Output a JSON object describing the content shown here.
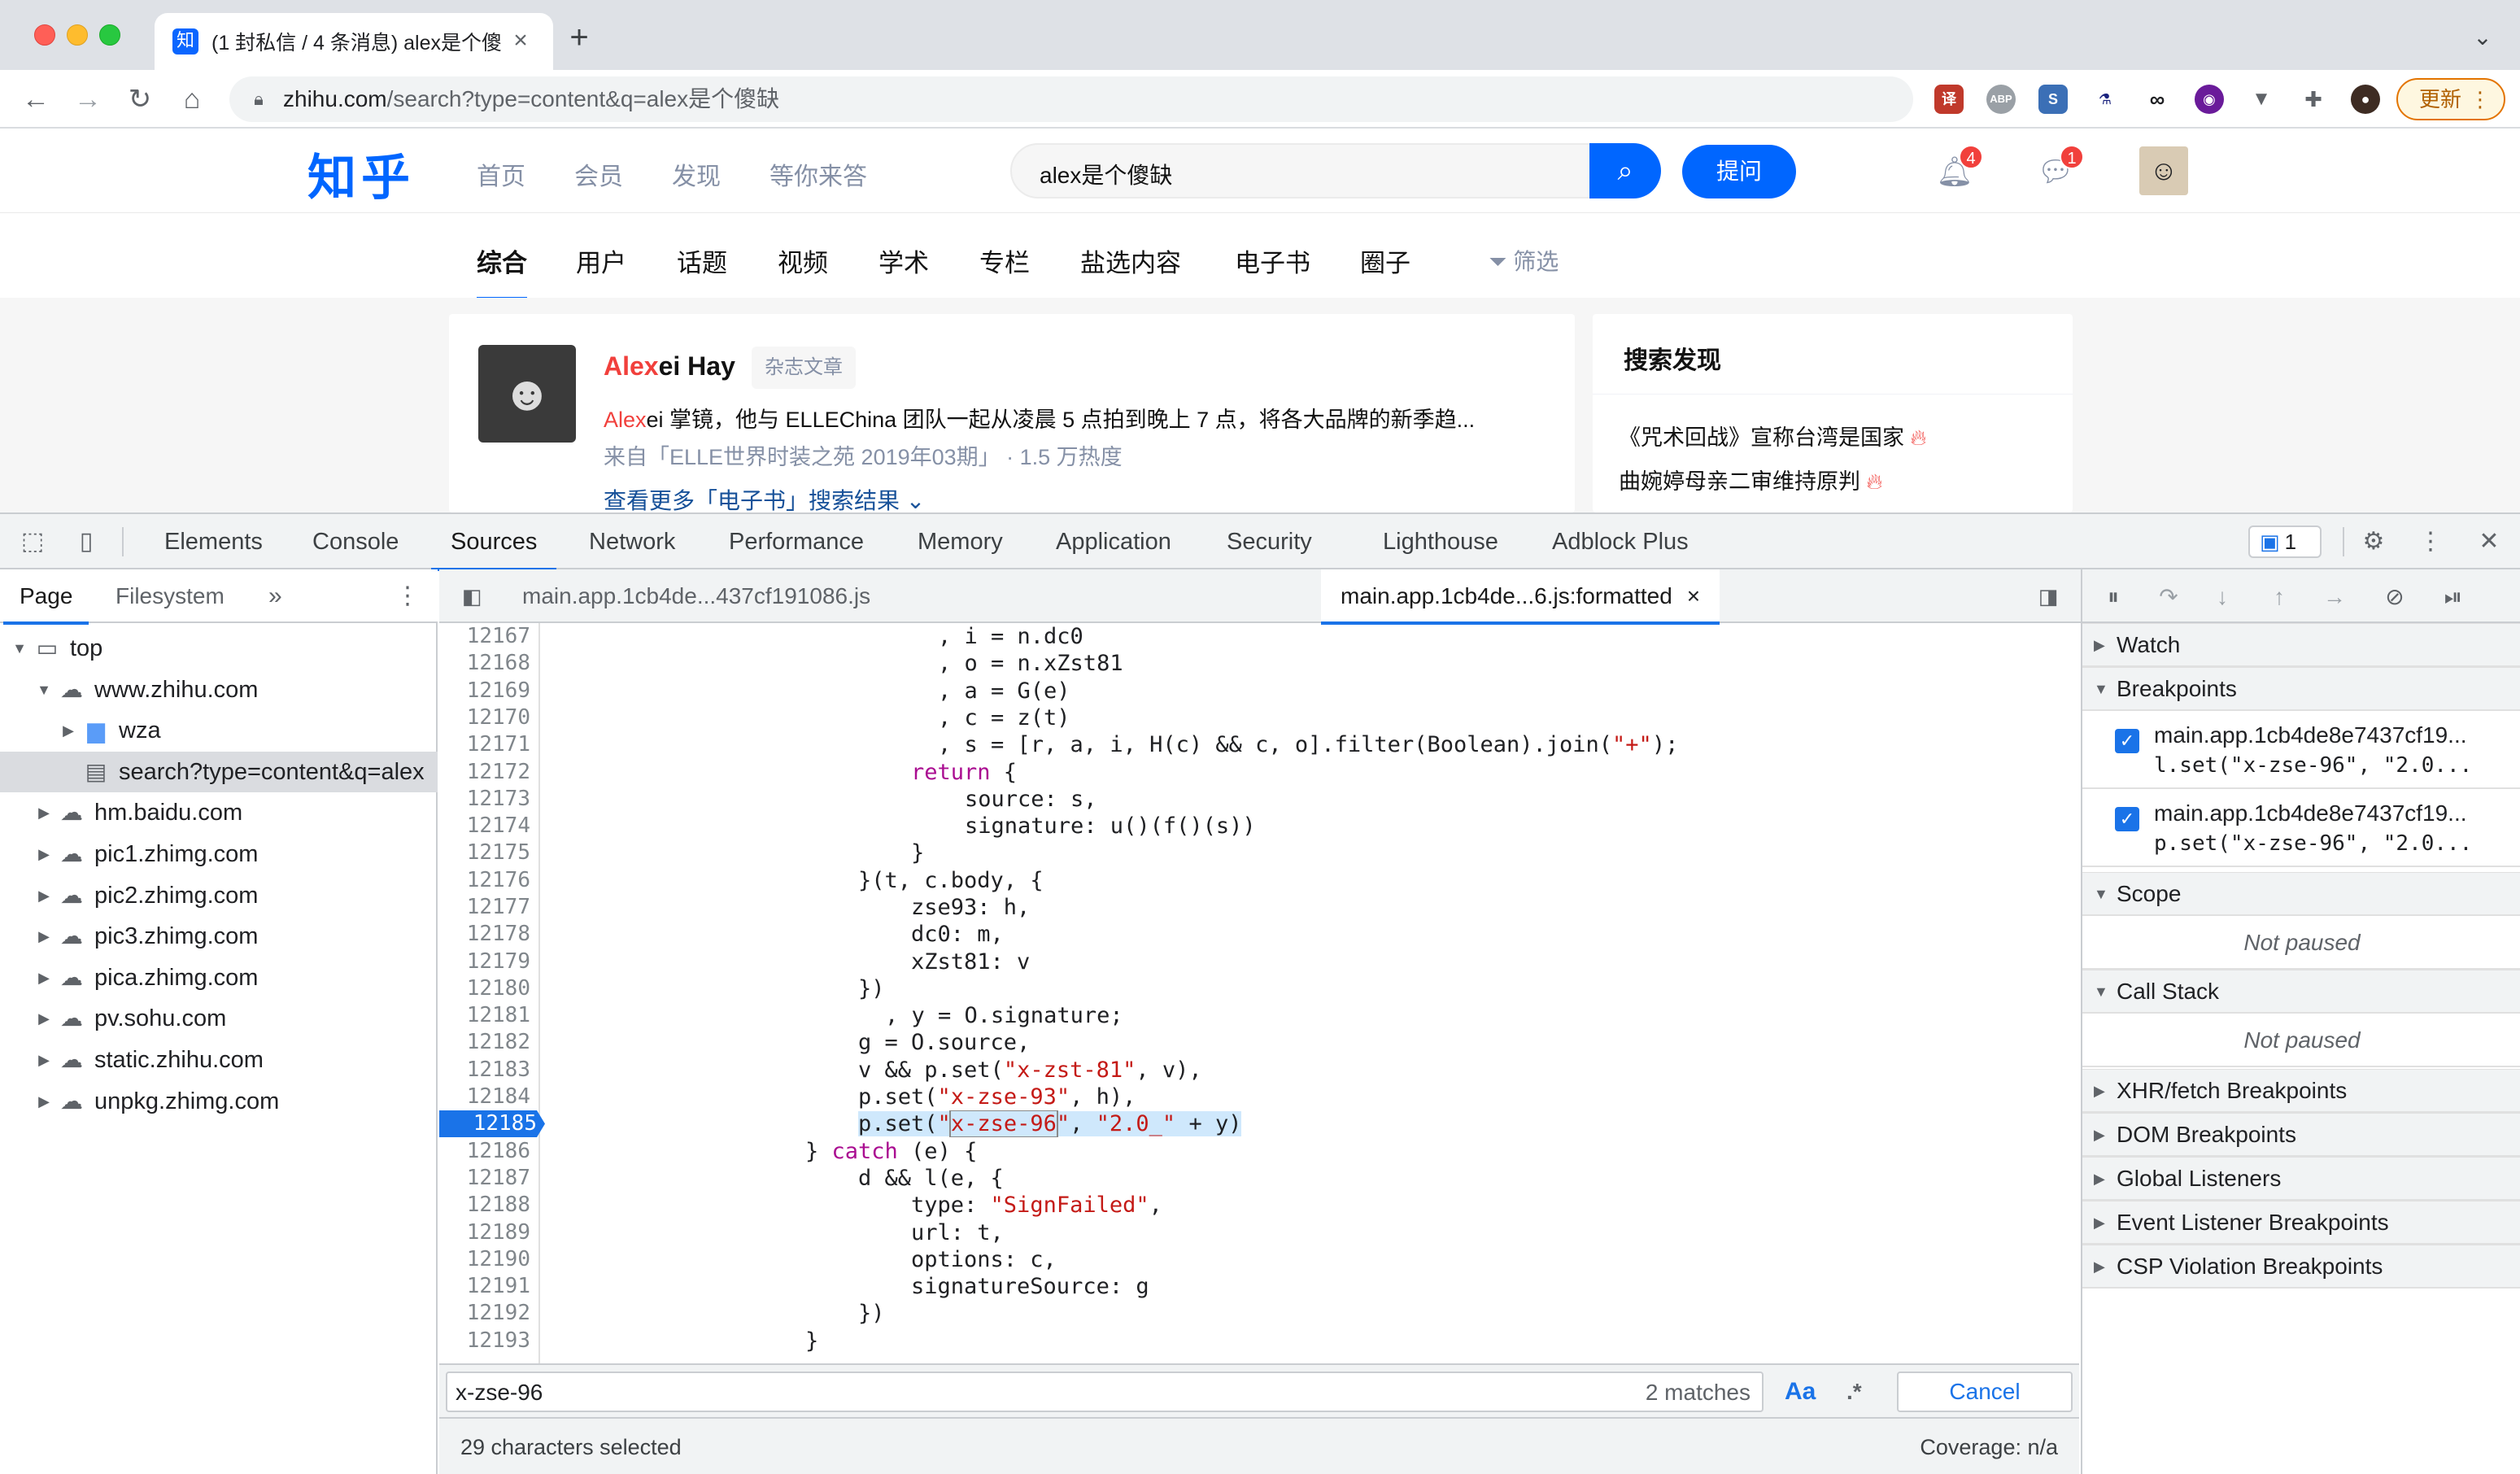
{
  "browser": {
    "tab_title": "(1 封私信 / 4 条消息) alex是个傻",
    "tab_favicon": "知",
    "url_host": "zhihu.com",
    "url_path": "/search?type=content&q=alex是个傻缺",
    "update_label": "更新",
    "icons": [
      "back-icon",
      "forward-icon",
      "reload-icon",
      "home-icon",
      "lock-icon",
      "share-icon",
      "star-icon",
      "extensions-icon",
      "profile-icon",
      "menu-icon"
    ]
  },
  "zhihu": {
    "logo": "知乎",
    "nav": [
      "首页",
      "会员",
      "发现",
      "等你来答"
    ],
    "search_value": "alex是个傻缺",
    "ask_label": "提问",
    "notifications_badge": "4",
    "messages_badge": "1",
    "tabs": [
      "综合",
      "用户",
      "话题",
      "视频",
      "学术",
      "专栏",
      "盐选内容",
      "电子书",
      "圈子"
    ],
    "filter_label": "筛选",
    "card": {
      "name_hl": "Alex",
      "name_rest": "ei Hay",
      "tag": "杂志文章",
      "desc_hl": "Alex",
      "desc_rest": "ei 掌镜，他与 ELLEChina 团队一起从凌晨 5 点拍到晚上 7 点，将各大品牌的新季趋...",
      "meta": "来自「ELLE世界时装之苑 2019年03期」 · 1.5 万热度",
      "more": "查看更多「电子书」搜索结果"
    },
    "side": {
      "title": "搜索发现",
      "items": [
        "《咒术回战》宣称台湾是国家",
        "曲婉婷母亲二审维持原判"
      ]
    }
  },
  "devtools": {
    "tabs": [
      "Elements",
      "Console",
      "Sources",
      "Network",
      "Performance",
      "Memory",
      "Application",
      "Security",
      "Lighthouse",
      "Adblock Plus"
    ],
    "active_tab": "Sources",
    "issues_count": "1",
    "navigator": {
      "tabs": [
        "Page",
        "Filesystem"
      ],
      "tree": [
        {
          "label": "top",
          "depth": 0,
          "kind": "frame",
          "expanded": true
        },
        {
          "label": "www.zhihu.com",
          "depth": 1,
          "kind": "domain",
          "expanded": true
        },
        {
          "label": "wza",
          "depth": 2,
          "kind": "folder",
          "expanded": false
        },
        {
          "label": "search?type=content&q=alex",
          "depth": 2,
          "kind": "file",
          "selected": true
        },
        {
          "label": "hm.baidu.com",
          "depth": 1,
          "kind": "domain",
          "expanded": false
        },
        {
          "label": "pic1.zhimg.com",
          "depth": 1,
          "kind": "domain",
          "expanded": false
        },
        {
          "label": "pic2.zhimg.com",
          "depth": 1,
          "kind": "domain",
          "expanded": false
        },
        {
          "label": "pic3.zhimg.com",
          "depth": 1,
          "kind": "domain",
          "expanded": false
        },
        {
          "label": "pica.zhimg.com",
          "depth": 1,
          "kind": "domain",
          "expanded": false
        },
        {
          "label": "pv.sohu.com",
          "depth": 1,
          "kind": "domain",
          "expanded": false
        },
        {
          "label": "static.zhihu.com",
          "depth": 1,
          "kind": "domain",
          "expanded": false
        },
        {
          "label": "unpkg.zhimg.com",
          "depth": 1,
          "kind": "domain",
          "expanded": false
        }
      ]
    },
    "editor": {
      "tabs": [
        "main.app.1cb4de...437cf191086.js",
        "main.app.1cb4de...6.js:formatted"
      ],
      "active_tab": 1,
      "breakpoint_line": 12185,
      "lines": [
        {
          "n": "12167",
          "indent": 30,
          "parts": [
            [
              ", i = n.dc0",
              ""
            ]
          ]
        },
        {
          "n": "12168",
          "indent": 30,
          "parts": [
            [
              ", o = n.xZst81",
              ""
            ]
          ]
        },
        {
          "n": "12169",
          "indent": 30,
          "parts": [
            [
              ", a = G(e)",
              ""
            ]
          ]
        },
        {
          "n": "12170",
          "indent": 30,
          "parts": [
            [
              ", c = z(t)",
              ""
            ]
          ]
        },
        {
          "n": "12171",
          "indent": 30,
          "parts": [
            [
              ", s = [r, a, i, H(c) && c, o].filter(Boolean).join(",
              ""
            ],
            [
              "\"+\"",
              "str"
            ],
            [
              ");",
              ""
            ]
          ]
        },
        {
          "n": "12172",
          "indent": 28,
          "parts": [
            [
              "return",
              "kw"
            ],
            [
              " {",
              ""
            ]
          ]
        },
        {
          "n": "12173",
          "indent": 32,
          "parts": [
            [
              "source: s,",
              ""
            ]
          ]
        },
        {
          "n": "12174",
          "indent": 32,
          "parts": [
            [
              "signature: u()(f()(s))",
              ""
            ]
          ]
        },
        {
          "n": "12175",
          "indent": 28,
          "parts": [
            [
              "}",
              ""
            ]
          ]
        },
        {
          "n": "12176",
          "indent": 24,
          "parts": [
            [
              "}(t, c.body, {",
              ""
            ]
          ]
        },
        {
          "n": "12177",
          "indent": 28,
          "parts": [
            [
              "zse93: h,",
              ""
            ]
          ]
        },
        {
          "n": "12178",
          "indent": 28,
          "parts": [
            [
              "dc0: m,",
              ""
            ]
          ]
        },
        {
          "n": "12179",
          "indent": 28,
          "parts": [
            [
              "xZst81: v",
              ""
            ]
          ]
        },
        {
          "n": "12180",
          "indent": 24,
          "parts": [
            [
              "})",
              ""
            ]
          ]
        },
        {
          "n": "12181",
          "indent": 26,
          "parts": [
            [
              ", y = O.signature;",
              ""
            ]
          ]
        },
        {
          "n": "12182",
          "indent": 24,
          "parts": [
            [
              "g = O.source,",
              ""
            ]
          ]
        },
        {
          "n": "12183",
          "indent": 24,
          "parts": [
            [
              "v && p.set(",
              ""
            ],
            [
              "\"x-zst-81\"",
              "str"
            ],
            [
              ", v),",
              ""
            ]
          ]
        },
        {
          "n": "12184",
          "indent": 24,
          "parts": [
            [
              "p.set(",
              ""
            ],
            [
              "\"x-zse-93\"",
              "str"
            ],
            [
              ", h),",
              ""
            ]
          ]
        },
        {
          "n": "12185",
          "indent": 24,
          "highlight": true,
          "parts": [
            [
              "p.set(",
              ""
            ],
            [
              "\"",
              "str"
            ],
            [
              "x-zse-96",
              "str sel"
            ],
            [
              "\"",
              "str"
            ],
            [
              ", ",
              ""
            ],
            [
              "\"2.0_\"",
              "str"
            ],
            [
              " + y)",
              ""
            ]
          ]
        },
        {
          "n": "12186",
          "indent": 20,
          "parts": [
            [
              "} ",
              ""
            ],
            [
              "catch",
              "kw"
            ],
            [
              " (e) {",
              ""
            ]
          ]
        },
        {
          "n": "12187",
          "indent": 24,
          "parts": [
            [
              "d && l(e, {",
              ""
            ]
          ]
        },
        {
          "n": "12188",
          "indent": 28,
          "parts": [
            [
              "type: ",
              ""
            ],
            [
              "\"SignFailed\"",
              "str"
            ],
            [
              ",",
              ""
            ]
          ]
        },
        {
          "n": "12189",
          "indent": 28,
          "parts": [
            [
              "url: t,",
              ""
            ]
          ]
        },
        {
          "n": "12190",
          "indent": 28,
          "parts": [
            [
              "options: c,",
              ""
            ]
          ]
        },
        {
          "n": "12191",
          "indent": 28,
          "parts": [
            [
              "signatureSource: g",
              ""
            ]
          ]
        },
        {
          "n": "12192",
          "indent": 24,
          "parts": [
            [
              "})",
              ""
            ]
          ]
        },
        {
          "n": "12193",
          "indent": 20,
          "parts": [
            [
              "}",
              ""
            ]
          ]
        }
      ]
    },
    "search": {
      "query": "x-zse-96",
      "matches": "2 matches",
      "case_label": "Aa",
      "regex_label": ".*",
      "cancel_label": "Cancel"
    },
    "status": {
      "selection": "29 characters selected",
      "coverage": "Coverage: n/a"
    },
    "debugger": {
      "watch": "Watch",
      "breakpoints_title": "Breakpoints",
      "breakpoints": [
        {
          "file": "main.app.1cb4de8e7437cf19...",
          "code": "l.set(\"x-zse-96\", \"2.0..."
        },
        {
          "file": "main.app.1cb4de8e7437cf19...",
          "code": "p.set(\"x-zse-96\", \"2.0..."
        }
      ],
      "scope_title": "Scope",
      "scope_status": "Not paused",
      "callstack_title": "Call Stack",
      "callstack_status": "Not paused",
      "collapsed_sections": [
        "XHR/fetch Breakpoints",
        "DOM Breakpoints",
        "Global Listeners",
        "Event Listener Breakpoints",
        "CSP Violation Breakpoints"
      ]
    }
  }
}
